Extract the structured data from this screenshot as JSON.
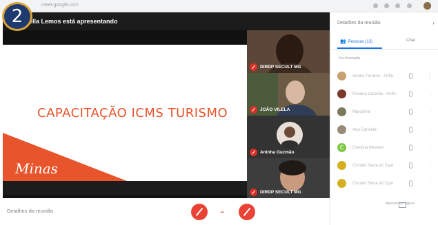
{
  "badge": "2",
  "browser": {
    "url": "meet.google.com"
  },
  "stage": {
    "presenting_text": "ella Lemos está apresentando",
    "slide_title": "CAPACITAÇÃO ICMS TURISMO",
    "slide_logo": "Minas"
  },
  "tiles": [
    {
      "name": "DIRDP SECULT MG"
    },
    {
      "name": "JOÃO VILELA"
    },
    {
      "name": "Aninha Guzmão"
    },
    {
      "name": "DIRDP SECULT MG"
    }
  ],
  "panel": {
    "title": "Detalhes da reunião",
    "people_tab": "Pessoas (13)",
    "chat_tab": "Chat",
    "participants_caption": "Na chamada",
    "participants": [
      {
        "name": "Ariane Ferreira · Anfitr.",
        "initial": ""
      },
      {
        "name": "Rosana Lacerda · Anfitr.",
        "initial": ""
      },
      {
        "name": "Marcilene",
        "initial": ""
      },
      {
        "name": "Ana Carolina",
        "initial": ""
      },
      {
        "name": "Carolina Mendes",
        "initial": "C"
      },
      {
        "name": "Circuito Serra do Cipó",
        "initial": ""
      },
      {
        "name": "Circuito Serra do Cipó",
        "initial": ""
      }
    ]
  },
  "bottom": {
    "meeting_details": "Detalhes da reunião",
    "present_now": "Apresentar agora"
  },
  "colors": {
    "slide_accent": "#e8542c",
    "mic_off": "#d93025",
    "link_blue": "#1a73e8"
  }
}
